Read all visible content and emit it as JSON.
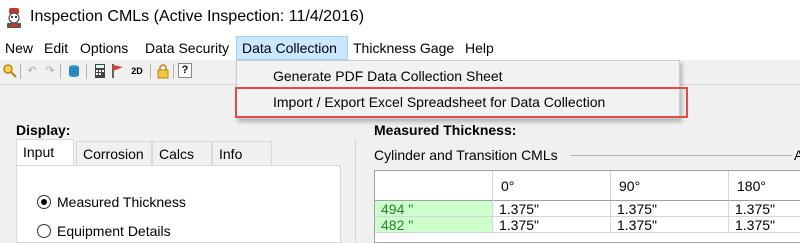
{
  "window": {
    "title": "Inspection CMLs (Active Inspection:  11/4/2016)",
    "icon": "robot-inspector-icon"
  },
  "menu": {
    "items": [
      "New",
      "Edit",
      "Options",
      "Data Security",
      "Data Collection",
      "Thickness Gage",
      "Help"
    ],
    "active": "Data Collection"
  },
  "toolbar": {
    "icons": [
      "search-icon",
      "undo-icon",
      "redo-icon",
      "database-icon",
      "calculator-icon",
      "flag-icon",
      "2d-icon",
      "lock-icon",
      "help-icon"
    ],
    "label_2d": "2D",
    "help_glyph": "?"
  },
  "dropdown": {
    "items": [
      "Generate PDF Data Collection Sheet",
      "Import / Export Excel Spreadsheet for Data Collection"
    ],
    "highlight_color": "#e24b4b"
  },
  "display": {
    "label": "Display:",
    "tabs": [
      "Input",
      "Corrosion",
      "Calcs",
      "Info"
    ],
    "selected_tab": "Input",
    "options": [
      {
        "label": "Measured Thickness",
        "checked": true
      },
      {
        "label": "Equipment Details",
        "checked": false
      }
    ]
  },
  "measured": {
    "label": "Measured Thickness:",
    "group_label": "Cylinder and Transition CMLs",
    "group_label_2": "A",
    "columns": [
      "",
      "0°",
      "90°",
      "180°"
    ],
    "rows": [
      {
        "name": "494 \"",
        "values": [
          "1.375\"",
          "1.375\"",
          "1.375\""
        ]
      },
      {
        "name": "482 \"",
        "values": [
          "1.375\"",
          "1.375\"",
          "1.375\""
        ]
      }
    ],
    "name_cell_color": "#ccffcc"
  }
}
